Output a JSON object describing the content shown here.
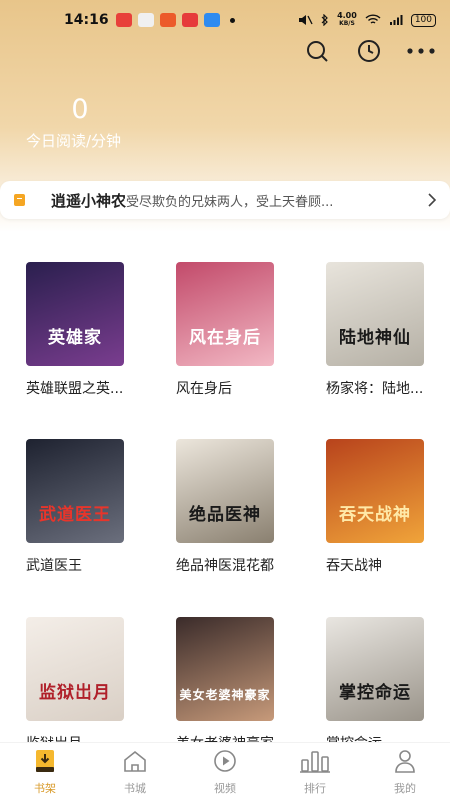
{
  "status": {
    "time": "14:16",
    "speed_top": "4.00",
    "speed_unit": "KB/S",
    "battery": "100"
  },
  "reading": {
    "minutes": "0",
    "label": "今日阅读/分钟"
  },
  "notice": {
    "title": "逍遥小神农",
    "description": "受尽欺负的兄妹两人，受上天眷顾..."
  },
  "books": [
    {
      "title": "英雄联盟之英...",
      "cover_text": "英雄家",
      "cover_colors": [
        "#2a1f4e",
        "#7a3d8f"
      ]
    },
    {
      "title": "风在身后",
      "cover_text": "风在身后",
      "cover_colors": [
        "#c24a6a",
        "#f2b8c4"
      ]
    },
    {
      "title": "杨家将：陆地...",
      "cover_text": "陆地神仙",
      "cover_colors": [
        "#e8e4dc",
        "#b5b0a5"
      ]
    },
    {
      "title": "武道医王",
      "cover_text": "武道医王",
      "cover_colors": [
        "#1e2230",
        "#6b6f7d"
      ]
    },
    {
      "title": "绝品神医混花都",
      "cover_text": "绝品医神",
      "cover_colors": [
        "#ece6dc",
        "#8a8070"
      ]
    },
    {
      "title": "吞天战神",
      "cover_text": "吞天战神",
      "cover_colors": [
        "#b8431c",
        "#f0a43a"
      ]
    },
    {
      "title": "监狱岀月",
      "cover_text": "监狱岀月",
      "cover_colors": [
        "#f4eee8",
        "#d9cfc5"
      ]
    },
    {
      "title": "美女老婆神豪家",
      "cover_text": "美女老婆神豪家",
      "cover_colors": [
        "#3a2b2a",
        "#c79a7a"
      ]
    },
    {
      "title": "掌控命运",
      "cover_text": "掌控命运",
      "cover_colors": [
        "#e9e6e1",
        "#9a948a"
      ]
    }
  ],
  "nav": [
    {
      "label": "书架",
      "icon": "bookshelf-icon",
      "active": true
    },
    {
      "label": "书城",
      "icon": "bookstore-icon",
      "active": false
    },
    {
      "label": "视频",
      "icon": "video-icon",
      "active": false
    },
    {
      "label": "排行",
      "icon": "ranking-icon",
      "active": false
    },
    {
      "label": "我的",
      "icon": "profile-icon",
      "active": false
    }
  ],
  "colors": {
    "accent": "#d99b2b",
    "header_top": "#e8c58a",
    "notice_icon": "#f5a623"
  }
}
